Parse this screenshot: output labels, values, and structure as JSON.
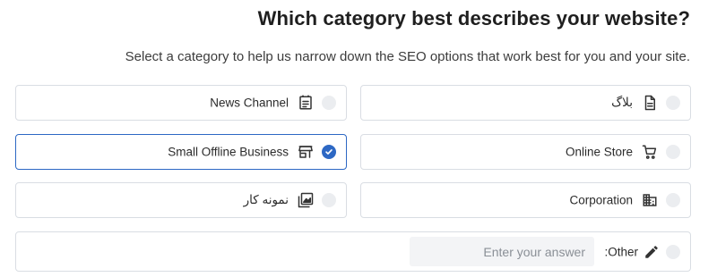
{
  "header": {
    "title": "?Which category best describes your website",
    "subtitle": ".Select a category to help us narrow down the SEO options that work best for you and your site"
  },
  "options": [
    {
      "label": "بلاگ",
      "icon": "document-icon",
      "selected": false
    },
    {
      "label": "News Channel",
      "icon": "newspaper-icon",
      "selected": false
    },
    {
      "label": "Online Store",
      "icon": "cart-icon",
      "selected": false
    },
    {
      "label": "Small Offline Business",
      "icon": "store-icon",
      "selected": true
    },
    {
      "label": "Corporation",
      "icon": "building-icon",
      "selected": false
    },
    {
      "label": "نمونه کار",
      "icon": "gallery-icon",
      "selected": false
    }
  ],
  "other": {
    "label": ":Other",
    "icon": "pencil-icon",
    "value": "",
    "placeholder": "Enter your answer",
    "selected": false
  },
  "colors": {
    "accent": "#2d68c4",
    "border": "#d9dde3",
    "radio_bg": "#ebedf0",
    "input_bg": "#f3f4f6"
  }
}
